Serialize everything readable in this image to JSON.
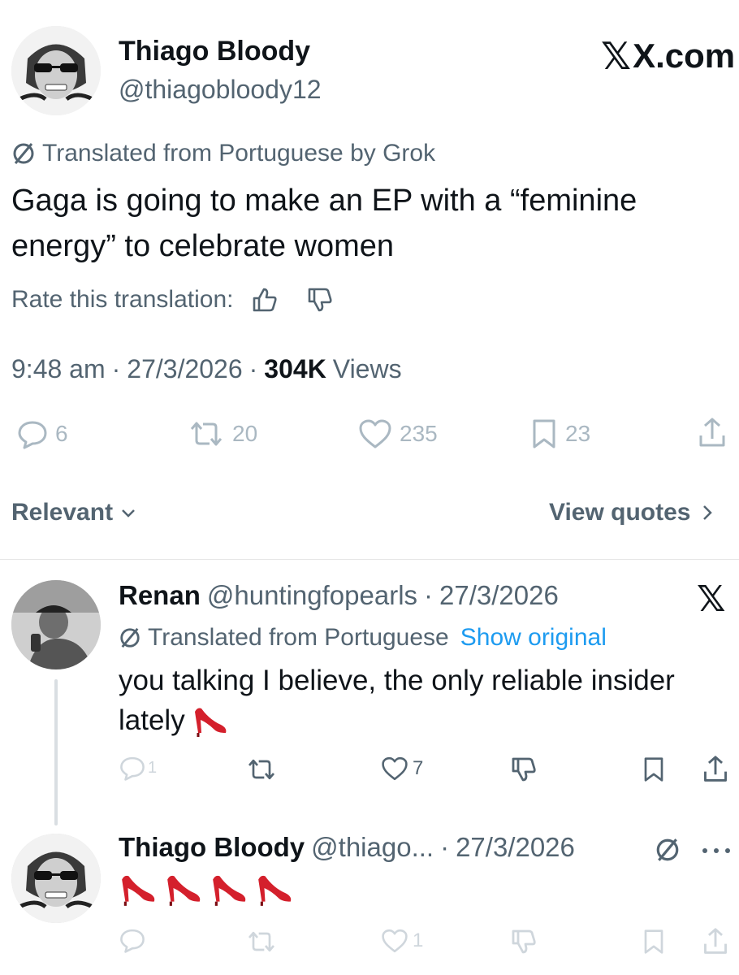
{
  "post": {
    "author_name": "Thiago Bloody",
    "author_handle": "@thiagobloody12",
    "site_label": "X.com",
    "translated_notice": "Translated from Portuguese by Grok",
    "text_line1": "Gaga is going to make an EP with a “feminine",
    "text_line2": "energy” to celebrate women",
    "rate_label": "Rate this translation:",
    "time": "9:48 am",
    "date": "27/3/2026",
    "views_count": "304K",
    "views_label": "Views",
    "reply_count": "6",
    "repost_count": "20",
    "like_count": "235",
    "bookmark_count": "23"
  },
  "filters": {
    "sort_label": "Relevant",
    "view_quotes_label": "View quotes"
  },
  "reply1": {
    "author_name": "Renan",
    "author_handle": "@huntingfopearls",
    "date": "27/3/2026",
    "translated_notice": "Translated from Portuguese",
    "show_original": "Show original",
    "text_line1": "you talking I believe, the only reliable insider",
    "text_line2": "lately",
    "reply_count": "1",
    "like_count": "7"
  },
  "reply2": {
    "author_name": "Thiago Bloody",
    "author_handle": "@thiago...",
    "date": "27/3/2026",
    "like_count": "1"
  },
  "separator": "·",
  "colors": {
    "link_blue": "#1d9bf0",
    "muted": "#536471",
    "icon_gray": "#aab8c2",
    "heel_red": "#d4202c"
  }
}
